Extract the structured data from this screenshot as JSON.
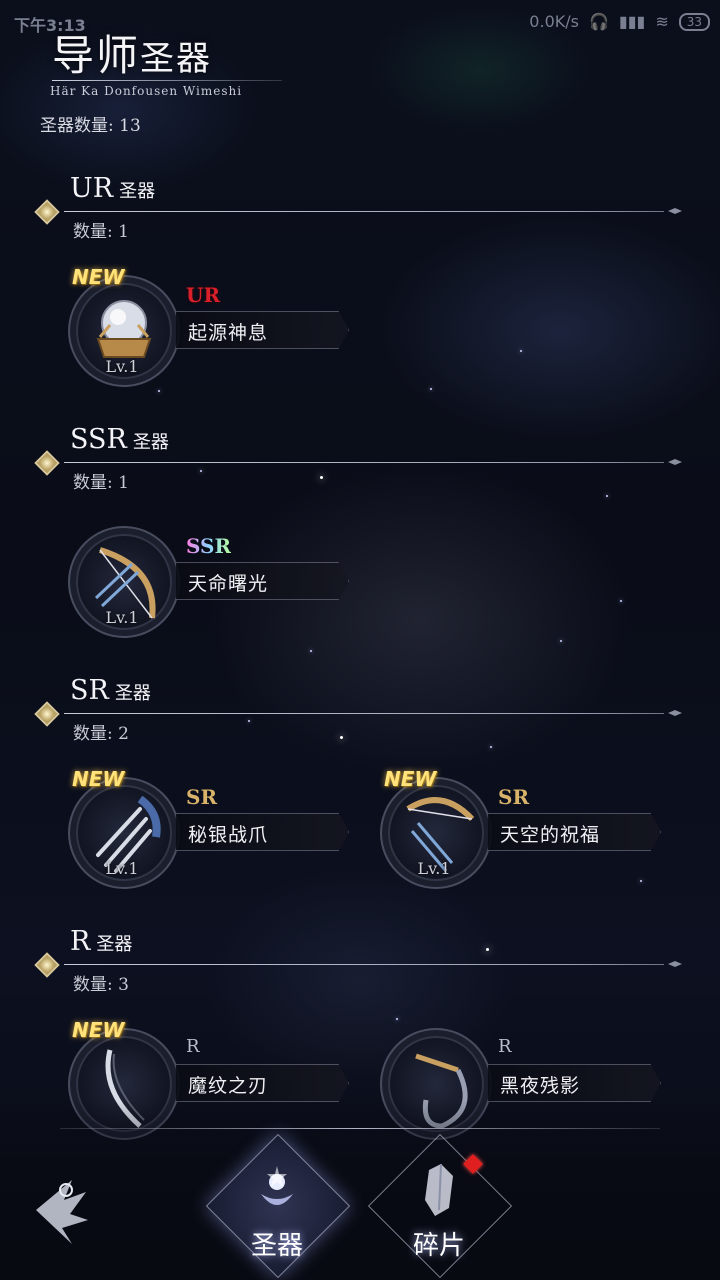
{
  "status_bar": {
    "time": "下午3:13",
    "speed": "0.0K/s",
    "battery": "33"
  },
  "header": {
    "title_main": "导师",
    "title_sub": "圣器",
    "subtitle": "Här Ka Donfousen Wimeshi",
    "total_label": "圣器数量: 13"
  },
  "sections": [
    {
      "title": "UR",
      "suffix": "圣器",
      "count": "数量: 1",
      "items": [
        {
          "new": "NEW",
          "rarity": "UR",
          "name": "起源神息",
          "level": "Lv.1"
        }
      ]
    },
    {
      "title": "SSR",
      "suffix": "圣器",
      "count": "数量: 1",
      "items": [
        {
          "rarity": "SSR",
          "name": "天命曙光",
          "level": "Lv.1"
        }
      ]
    },
    {
      "title": "SR",
      "suffix": "圣器",
      "count": "数量: 2",
      "items": [
        {
          "new": "NEW",
          "rarity": "SR",
          "name": "秘银战爪",
          "level": "Lv.1"
        },
        {
          "new": "NEW",
          "rarity": "SR",
          "name": "天空的祝福",
          "level": "Lv.1"
        }
      ]
    },
    {
      "title": "R",
      "suffix": "圣器",
      "count": "数量: 3",
      "items": [
        {
          "new": "NEW",
          "rarity": "R",
          "name": "魔纹之刃"
        },
        {
          "rarity": "R",
          "name": "黑夜残影"
        }
      ]
    }
  ],
  "nav": {
    "tab_artifacts": "圣器",
    "tab_fragments": "碎片"
  },
  "colors": {
    "ur": "#d8202a",
    "sr": "#d9b36a",
    "new": "#ffe27a",
    "badge": "#e02020"
  },
  "icons": {
    "back": "feather-wing-back-icon",
    "artifacts": "crest-icon",
    "fragments": "crystal-shard-icon",
    "ur_item": "crystal-orb-icon",
    "ssr_item": "ornate-bow-icon",
    "sr_item_1": "claw-blade-icon",
    "sr_item_2": "sky-bow-icon",
    "r_item_1": "curved-blade-icon",
    "r_item_2": "dark-scythe-icon"
  }
}
